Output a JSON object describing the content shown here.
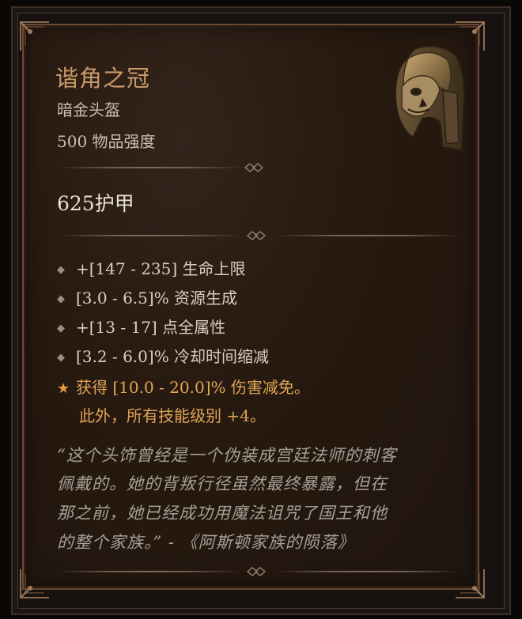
{
  "item": {
    "name": "谐角之冠",
    "type": "暗金头盔",
    "power": "500 物品强度",
    "armor": "625护甲"
  },
  "affixes": [
    {
      "bullet": "◆",
      "text": "+[147 - 235] 生命上限"
    },
    {
      "bullet": "◆",
      "text": "[3.0 - 6.5]% 资源生成"
    },
    {
      "bullet": "◆",
      "text": "+[13 - 17] 点全属性"
    },
    {
      "bullet": "◆",
      "text": "[3.2 - 6.0]% 冷却时间缩减"
    }
  ],
  "legendary_affix": {
    "bullet": "★",
    "line1": "获得 [10.0 - 20.0]% 伤害减免。",
    "line2": "此外，所有技能级别 +4。"
  },
  "flavor_text": [
    "“这个头饰曾经是一个伪装成宫廷法师的刺客",
    "佩戴的。她的背叛行径虽然最终暴露，但在",
    "那之前，她已经成功用魔法诅咒了国王和他",
    "的整个家族。” - 《阿斯顿家族的陨落》"
  ],
  "icons": {
    "item_image": "helmet-icon",
    "affix_bullet": "diamond-bullet-icon",
    "legendary_bullet": "star-icon"
  },
  "colors": {
    "item_name": "#c79a6a",
    "legendary": "#e0a456",
    "affix": "#d9cfc2",
    "flavor": "#a7a096",
    "border": "#6b4a34"
  }
}
